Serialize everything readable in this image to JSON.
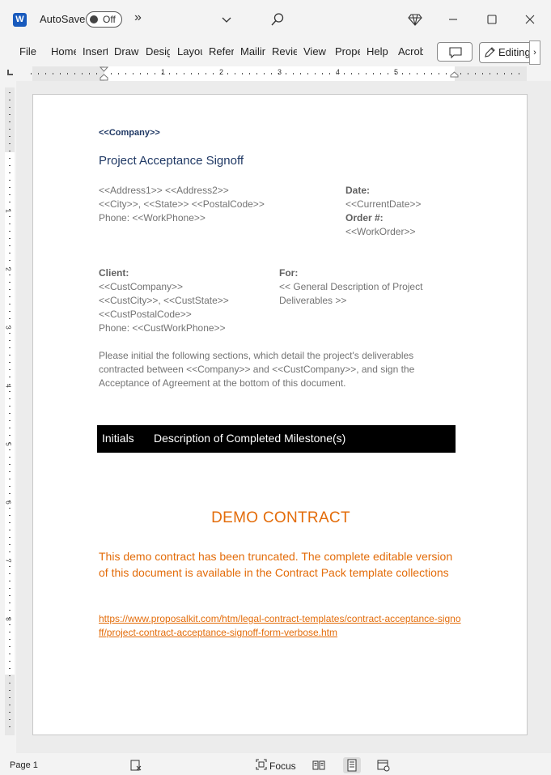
{
  "titlebar": {
    "app_icon": "word-icon",
    "app_icon_letter": "W",
    "autosave_label": "AutoSave",
    "autosave_state": "Off",
    "more_commands": "»"
  },
  "ribbon": {
    "tabs": [
      {
        "label": "File"
      },
      {
        "label": "Home"
      },
      {
        "label": "Insert"
      },
      {
        "label": "Draw"
      },
      {
        "label": "Design"
      },
      {
        "label": "Layout"
      },
      {
        "label": "References"
      },
      {
        "label": "Mailings"
      },
      {
        "label": "Review"
      },
      {
        "label": "View"
      },
      {
        "label": "Properties"
      },
      {
        "label": "Help"
      },
      {
        "label": "Acrobat"
      }
    ],
    "editing_label": "Editing",
    "scroll_right": "›"
  },
  "ruler": {
    "numbers": [
      "1",
      "2",
      "3",
      "4",
      "5"
    ],
    "vertical_numbers": [
      "1",
      "2",
      "3",
      "4",
      "5",
      "6",
      "7",
      "8"
    ]
  },
  "document": {
    "company": "<<Company>>",
    "title": "Project Acceptance Signoff",
    "address": {
      "line1": "<<Address1>> <<Address2>>",
      "line2": "<<City>>, <<State>> <<PostalCode>>",
      "line3": "Phone: <<WorkPhone>>"
    },
    "date_label": "Date:",
    "date_value": "<<CurrentDate>>",
    "order_label": "Order #:",
    "order_value": "<<WorkOrder>>",
    "client_label": "Client:",
    "client": {
      "line1": "<<CustCompany>>",
      "line2": "<<CustCity>>, <<CustState>>",
      "line3": "<<CustPostalCode>>",
      "line4": "Phone: <<CustWorkPhone>>"
    },
    "for_label": "For:",
    "for_value": "<< General Description of Project Deliverables >>",
    "intro": "Please initial the following sections, which detail the project's deliverables contracted between <<Company>> and <<CustCompany>>, and sign the Acceptance of Agreement at the bottom of this document.",
    "table_headers": [
      "Initials",
      "Description of Completed Milestone(s)"
    ],
    "demo_title": "DEMO CONTRACT",
    "demo_text": "This demo contract has been truncated. The complete editable version of this document is available in the Contract Pack template collections",
    "demo_link": "https://www.proposalkit.com/htm/legal-contract-templates/contract-acceptance-signoff/project-contract-acceptance-signoff-form-verbose.htm"
  },
  "statusbar": {
    "page": "Page 1",
    "focus_label": "Focus"
  }
}
